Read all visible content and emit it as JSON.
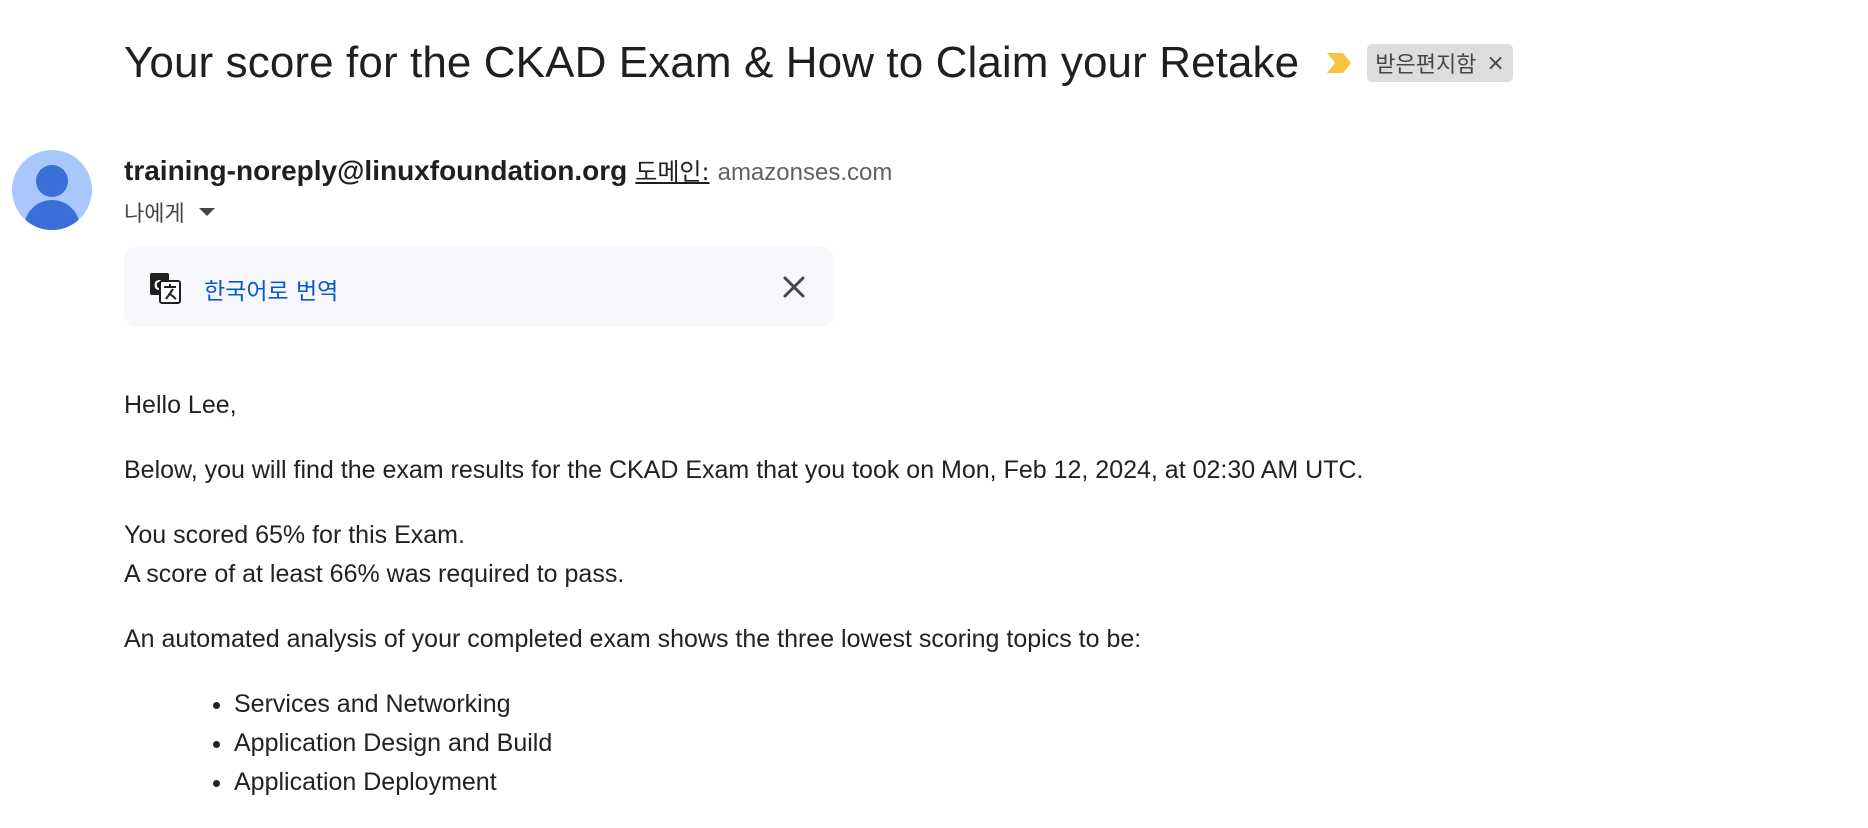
{
  "email": {
    "subject": "Your score for the CKAD Exam & How to Claim your Retake",
    "label_chip": "받은편지함",
    "label_chip_close": "×",
    "sender": {
      "email": "training-noreply@linuxfoundation.org",
      "domain_label": "도메인:",
      "domain_value": "amazonses.com"
    },
    "recipient_summary": "나에게",
    "translate": {
      "link_text": "한국어로 번역"
    },
    "body": {
      "greeting": "Hello Lee,",
      "intro": "Below, you will find the exam results for the CKAD Exam that you took on Mon, Feb 12, 2024, at 02:30 AM UTC.",
      "score_line": "You scored 65% for this Exam.",
      "required_line": "A score of at least 66% was required to pass.",
      "analysis_intro": "An automated analysis of your completed exam shows the three lowest scoring topics to be:",
      "topics": [
        "Services and Networking",
        "Application Design and Build",
        "Application Deployment"
      ]
    }
  },
  "colors": {
    "importance_marker": "#f4c542",
    "avatar_bg": "#a8c7fa",
    "avatar_fg": "#3b6fd8",
    "link_blue": "#0b57d0",
    "translate_bar_bg": "#f5f7fb"
  },
  "icons": {
    "importance": "importance-marker-icon",
    "translate": "translate-icon",
    "close": "close-icon",
    "caret": "caret-down-icon"
  }
}
